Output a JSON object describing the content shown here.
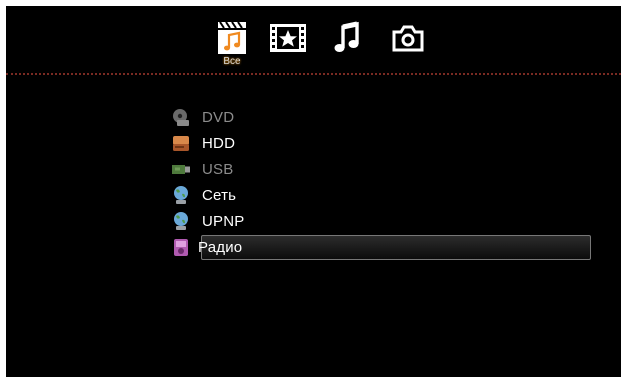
{
  "categories": [
    {
      "id": "all",
      "label": "Все",
      "icon": "clapperboard-music-icon",
      "active": true
    },
    {
      "id": "video",
      "label": "",
      "icon": "film-star-icon",
      "active": false
    },
    {
      "id": "music",
      "label": "",
      "icon": "music-note-icon",
      "active": false
    },
    {
      "id": "photo",
      "label": "",
      "icon": "camera-icon",
      "active": false
    }
  ],
  "sources": [
    {
      "label": "DVD",
      "icon": "dvd-drive-icon",
      "enabled": false,
      "selected": false
    },
    {
      "label": "HDD",
      "icon": "hard-drive-icon",
      "enabled": true,
      "selected": false
    },
    {
      "label": "USB",
      "icon": "usb-icon",
      "enabled": false,
      "selected": false
    },
    {
      "label": "Сеть",
      "icon": "network-globe-icon",
      "enabled": true,
      "selected": false
    },
    {
      "label": "UPNP",
      "icon": "upnp-globe-icon",
      "enabled": true,
      "selected": false
    },
    {
      "label": "Радио",
      "icon": "radio-icon",
      "enabled": true,
      "selected": true
    }
  ],
  "colors": {
    "background": "#000000",
    "accent": "#ff9900",
    "divider": "#7a2a22",
    "dimText": "#8c8c8c"
  }
}
